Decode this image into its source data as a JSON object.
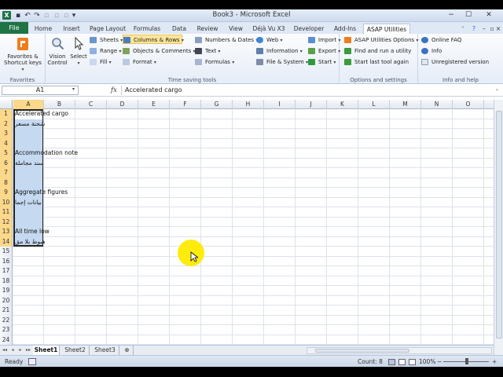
{
  "window": {
    "title": "Book3 - Microsoft Excel",
    "minimize": "−",
    "maximize": "☐",
    "close": "✕"
  },
  "tabs": {
    "file": "File",
    "items": [
      "Home",
      "Insert",
      "Page Layout",
      "Formulas",
      "Data",
      "Review",
      "View",
      "Déjà Vu X3",
      "Developer",
      "Add-Ins",
      "ASAP Utilities"
    ],
    "active": "ASAP Utilities"
  },
  "ribbon": {
    "favorites": {
      "label": "Favorites",
      "button": "Favorites &",
      "button2": "Shortcut keys",
      "caret": "▾"
    },
    "time_saving": {
      "label": "Time saving tools",
      "vision": "Vision",
      "vision2": "Control",
      "select": "Select",
      "caret": "▾",
      "col1": [
        "Sheets",
        "Range",
        "Fill"
      ],
      "col2": [
        "Columns & Rows",
        "Objects & Comments",
        "Format"
      ],
      "col3": [
        "Numbers & Dates",
        "Text",
        "Formulas"
      ],
      "col4": [
        "Web",
        "Information",
        "File & System"
      ],
      "col5": [
        "Import",
        "Export",
        "Start"
      ]
    },
    "options": {
      "label": "Options and settings",
      "items": [
        "ASAP Utilities Options",
        "Find and run a utility",
        "Start last tool again"
      ]
    },
    "info": {
      "label": "Info and help",
      "items": [
        "Online FAQ",
        "Info",
        "Unregistered version"
      ]
    }
  },
  "formula_bar": {
    "name_box": "A1",
    "fx": "fx",
    "content": "Accelerated cargo"
  },
  "grid": {
    "columns": [
      "A",
      "B",
      "C",
      "D",
      "E",
      "F",
      "G",
      "H",
      "I",
      "J",
      "K",
      "L",
      "M",
      "N",
      "O"
    ],
    "rows": [
      "1",
      "2",
      "3",
      "4",
      "5",
      "6",
      "7",
      "8",
      "9",
      "10",
      "11",
      "12",
      "13",
      "14",
      "15",
      "16",
      "17",
      "18",
      "19",
      "20",
      "21",
      "22",
      "23",
      "24"
    ],
    "cells": [
      {
        "row": 1,
        "text": "Accelerated cargo"
      },
      {
        "row": 2,
        "text": "شحنة مسعر"
      },
      {
        "row": 5,
        "text": "Accommodation note"
      },
      {
        "row": 6,
        "text": "سند مجاملة"
      },
      {
        "row": 9,
        "text": "Aggregate figures"
      },
      {
        "row": 10,
        "text": "بيانات إجما"
      },
      {
        "row": 13,
        "text": "All time low"
      },
      {
        "row": 14,
        "text": "هبوط بلا مق"
      }
    ]
  },
  "sheets": {
    "tabs": [
      "Sheet1",
      "Sheet2",
      "Sheet3"
    ],
    "active": "Sheet1",
    "nav": [
      "◂◂",
      "◂",
      "▸",
      "▸▸"
    ]
  },
  "status": {
    "ready": "Ready",
    "count": "Count: 8",
    "zoom": "100%",
    "zoom_minus": "−",
    "zoom_plus": "+"
  },
  "colors": {
    "excel_green": "#1f7345",
    "selection": "#c5d9f1",
    "header_selected": "#fbd88a",
    "cursor_highlight": "#ffeb00"
  }
}
